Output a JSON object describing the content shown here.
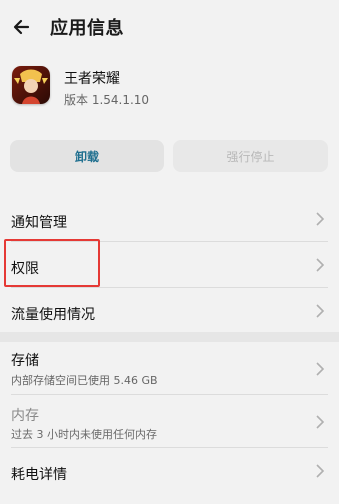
{
  "header": {
    "title": "应用信息"
  },
  "app": {
    "name": "王者荣耀",
    "version": "版本 1.54.1.10"
  },
  "actions": {
    "uninstall": "卸载",
    "force_stop": "强行停止"
  },
  "settings": [
    {
      "label": "通知管理"
    },
    {
      "label": "权限"
    },
    {
      "label": "流量使用情况"
    }
  ],
  "storage": [
    {
      "label": "存储",
      "sub": "内部存储空间已使用 5.46 GB"
    },
    {
      "label": "内存",
      "sub": "过去 3 小时内未使用任何内存"
    },
    {
      "label": "耗电详情"
    }
  ]
}
